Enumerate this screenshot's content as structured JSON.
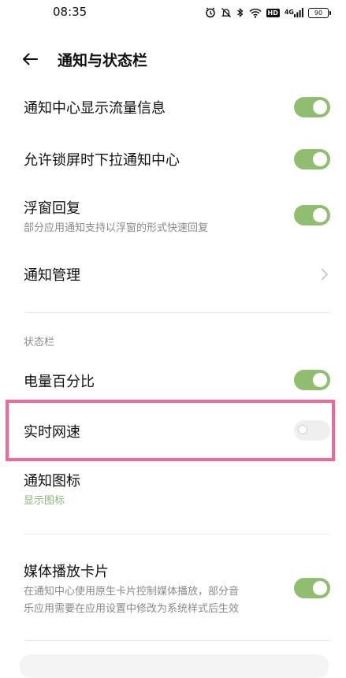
{
  "status_bar": {
    "time": "08:35",
    "icons": [
      "alarm-icon",
      "mute-icon",
      "bluetooth-icon",
      "wifi-icon",
      "hd-icon",
      "signal-icon",
      "battery-icon"
    ],
    "hd_label": "HD",
    "network_label": "4G",
    "battery_level": "90"
  },
  "header": {
    "title": "通知与状态栏"
  },
  "settings": {
    "traffic_info": {
      "title": "通知中心显示流量信息",
      "enabled": true
    },
    "lock_pull": {
      "title": "允许锁屏时下拉通知中心",
      "enabled": true
    },
    "float_reply": {
      "title": "浮窗回复",
      "subtitle": "部分应用通知支持以浮窗的形式快速回复",
      "enabled": true
    },
    "notification_manage": {
      "title": "通知管理"
    }
  },
  "status_section": {
    "label": "状态栏",
    "battery_percent": {
      "title": "电量百分比",
      "enabled": true
    },
    "realtime_speed": {
      "title": "实时网速",
      "enabled": false
    },
    "notification_icons": {
      "title": "通知图标",
      "value": "显示图标"
    }
  },
  "media": {
    "title": "媒体播放卡片",
    "subtitle_line1": "在通知中心使用原生卡片控制媒体播放，部分音",
    "subtitle_line2": "乐应用需要在应用设置中修改为系统样式后生效",
    "enabled": true
  },
  "colors": {
    "toggle_on": "#91bd71",
    "toggle_off": "#efefef",
    "highlight": "#f2689a",
    "accent_text": "#8ab878"
  }
}
